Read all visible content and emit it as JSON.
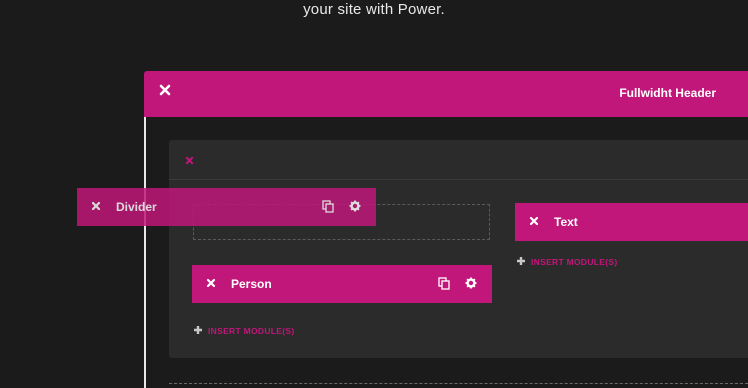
{
  "intro": {
    "text": "your site with Power."
  },
  "section": {
    "title": "Fullwidht Header"
  },
  "modules": {
    "divider": "Divider",
    "person": "Person",
    "text": "Text"
  },
  "insert_label": "INSERT MODULE(S)",
  "colors": {
    "accent": "#c1177a",
    "background": "#1b1b1b",
    "row_bg": "#2b2b2b"
  },
  "icons": {
    "close": "close-icon",
    "copy": "copy-icon",
    "settings": "gear-icon",
    "add": "plus-icon"
  }
}
